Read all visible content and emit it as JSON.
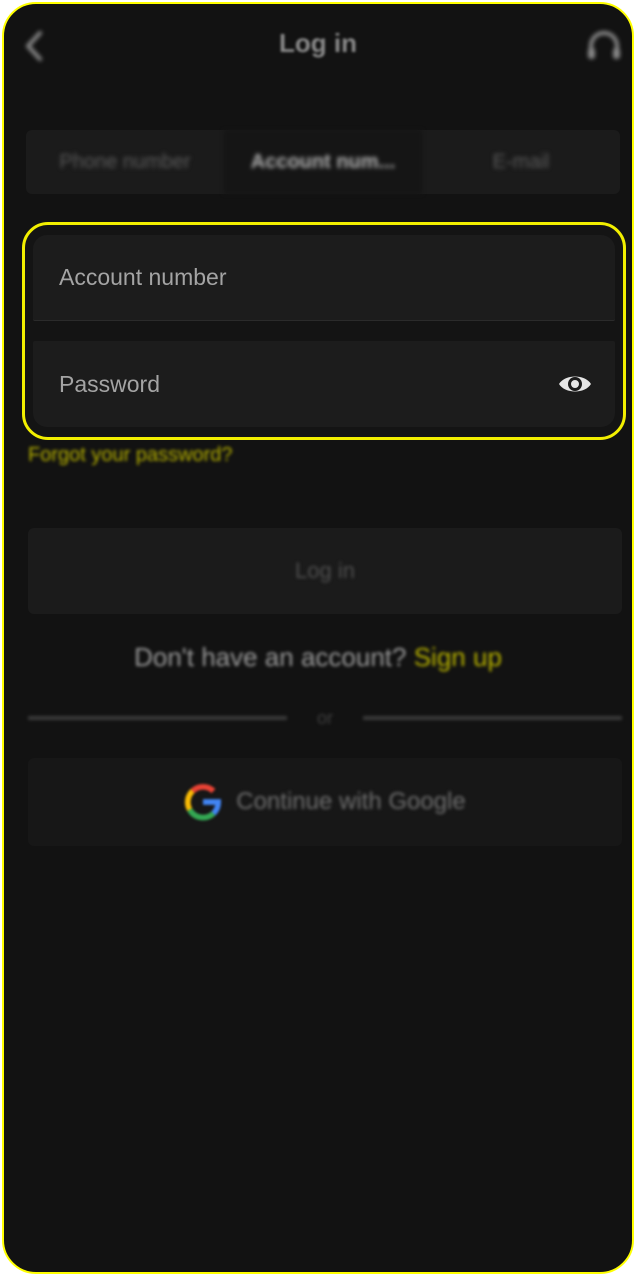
{
  "header": {
    "title": "Log in",
    "back_icon": "chevron-left-icon",
    "support_icon": "headset-icon"
  },
  "tabs": [
    {
      "label": "Phone number",
      "active": false
    },
    {
      "label": "Account num...",
      "active": true
    },
    {
      "label": "E-mail",
      "active": false
    }
  ],
  "form": {
    "account_placeholder": "Account number",
    "account_value": "",
    "password_placeholder": "Password",
    "password_value": "",
    "eye_icon": "eye-icon"
  },
  "forgot_password": "Forgot your password?",
  "login_button": "Log in",
  "signup": {
    "question": "Don't have an account?",
    "link": "Sign up"
  },
  "divider_text": "or",
  "google_button": "Continue with Google",
  "colors": {
    "background": "#121212",
    "accent_yellow": "#f2ef00",
    "link_yellow": "#b6b100"
  }
}
